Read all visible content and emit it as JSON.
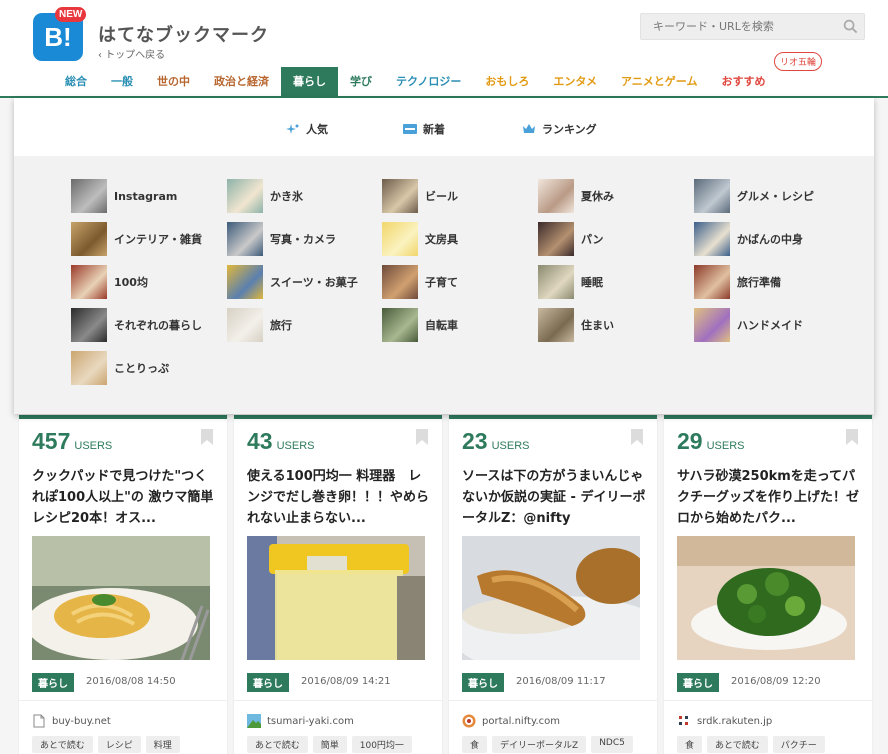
{
  "header": {
    "logo_text": "B!",
    "logo_badge": "NEW",
    "site_title": "はてなブックマーク",
    "back_link": "‹ トップへ戻る",
    "search_placeholder": "キーワード・URLを検索",
    "olympic_badge": "リオ五輪"
  },
  "nav": {
    "items": [
      {
        "label": "総合",
        "color": "#2c8fb4"
      },
      {
        "label": "一般",
        "color": "#2c8fb4"
      },
      {
        "label": "世の中",
        "color": "#b7652e"
      },
      {
        "label": "政治と経済",
        "color": "#b7652e"
      },
      {
        "label": "暮らし",
        "color": "#ffffff"
      },
      {
        "label": "学び",
        "color": "#2d7a5c"
      },
      {
        "label": "テクノロジー",
        "color": "#2c8fb4"
      },
      {
        "label": "おもしろ",
        "color": "#e39a13"
      },
      {
        "label": "エンタメ",
        "color": "#e39a13"
      },
      {
        "label": "アニメとゲーム",
        "color": "#e39a13"
      },
      {
        "label": "おすすめ",
        "color": "#e0473e"
      }
    ],
    "active_index": 4
  },
  "dropdown": {
    "top_links": [
      {
        "label": "人気",
        "icon": "sparkle-icon"
      },
      {
        "label": "新着",
        "icon": "new-badge-icon"
      },
      {
        "label": "ランキング",
        "icon": "crown-icon"
      }
    ],
    "categories": [
      [
        "Instagram",
        "インテリア・雑貨",
        "100均",
        "それぞれの暮らし",
        "ことりっぷ"
      ],
      [
        "かき氷",
        "写真・カメラ",
        "スイーツ・お菓子",
        "旅行"
      ],
      [
        "ビール",
        "文房具",
        "子育て",
        "自転車"
      ],
      [
        "夏休み",
        "パン",
        "睡眠",
        "住まい"
      ],
      [
        "グルメ・レシピ",
        "かばんの中身",
        "旅行準備",
        "ハンドメイド"
      ]
    ]
  },
  "cards": [
    {
      "users": "457",
      "users_unit": "USERS",
      "title": "クックパッドで見つけた\"つくれぽ100人以上\"の 激ウマ簡単レシピ20本！オス...",
      "tag": "暮らし",
      "date": "2016/08/08 14:50",
      "domain": "buy-buy.net",
      "tags": [
        "あとで読む",
        "レシピ",
        "料理"
      ]
    },
    {
      "users": "43",
      "users_unit": "USERS",
      "title": "使える100円均一 料理器　レンジでだし巻き卵！！！やめられない止まらない...",
      "tag": "暮らし",
      "date": "2016/08/09 14:21",
      "domain": "tsumari-yaki.com",
      "tags": [
        "あとで読む",
        "簡単",
        "100円均一"
      ]
    },
    {
      "users": "23",
      "users_unit": "USERS",
      "title": "ソースは下の方がうまいんじゃないか仮説の実証 - デイリーポータルZ：@nifty",
      "tag": "暮らし",
      "date": "2016/08/09 11:17",
      "domain": "portal.nifty.com",
      "tags": [
        "食",
        "デイリーポータルZ",
        "NDC5"
      ]
    },
    {
      "users": "29",
      "users_unit": "USERS",
      "title": "サハラ砂漠250kmを走ってパクチーグッズを作り上げた！ゼロから始めたパク...",
      "tag": "暮らし",
      "date": "2016/08/09 12:20",
      "domain": "srdk.rakuten.jp",
      "tags": [
        "食",
        "あとで読む",
        "パクチー"
      ]
    }
  ],
  "colors": {
    "accent": "#2d7a5c",
    "logo_blue": "#1a8ad6",
    "new_red": "#e8383d"
  }
}
